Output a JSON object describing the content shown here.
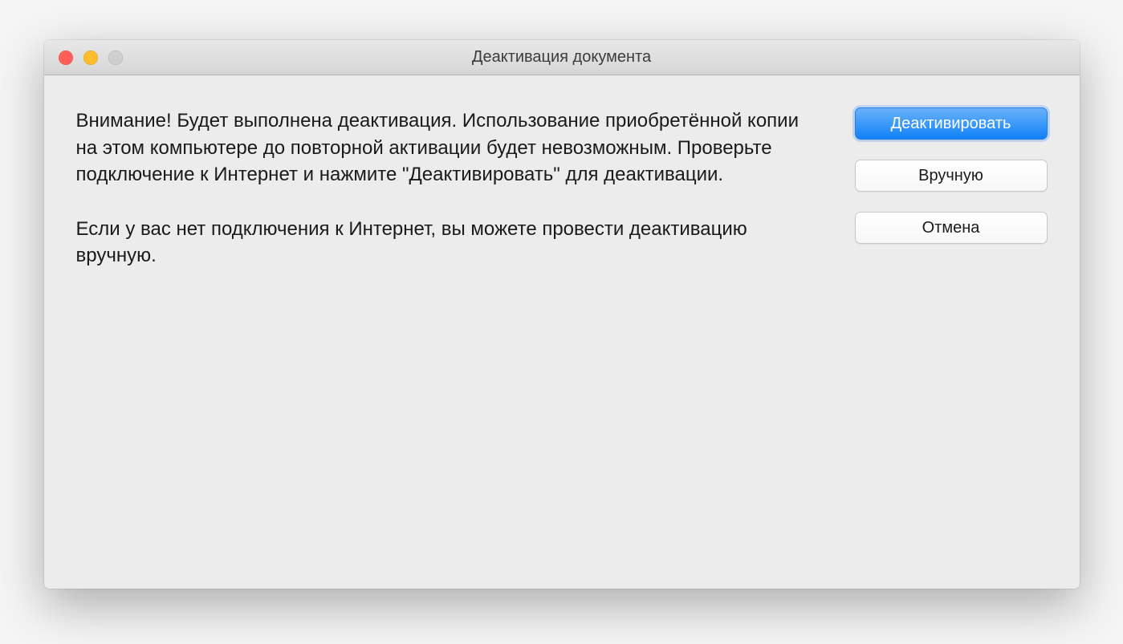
{
  "window": {
    "title": "Деактивация документа"
  },
  "message": {
    "paragraph1": "Внимание! Будет выполнена деактивация. Использование приобретённой копии на этом компьютере до повторной активации будет невозможным. Проверьте подключение к Интернет и нажмите \"Деактивировать\" для деактивации.",
    "paragraph2": "Если у вас нет подключения к Интернет, вы можете провести деактивацию вручную."
  },
  "buttons": {
    "deactivate": "Деактивировать",
    "manual": "Вручную",
    "cancel": "Отмена"
  }
}
